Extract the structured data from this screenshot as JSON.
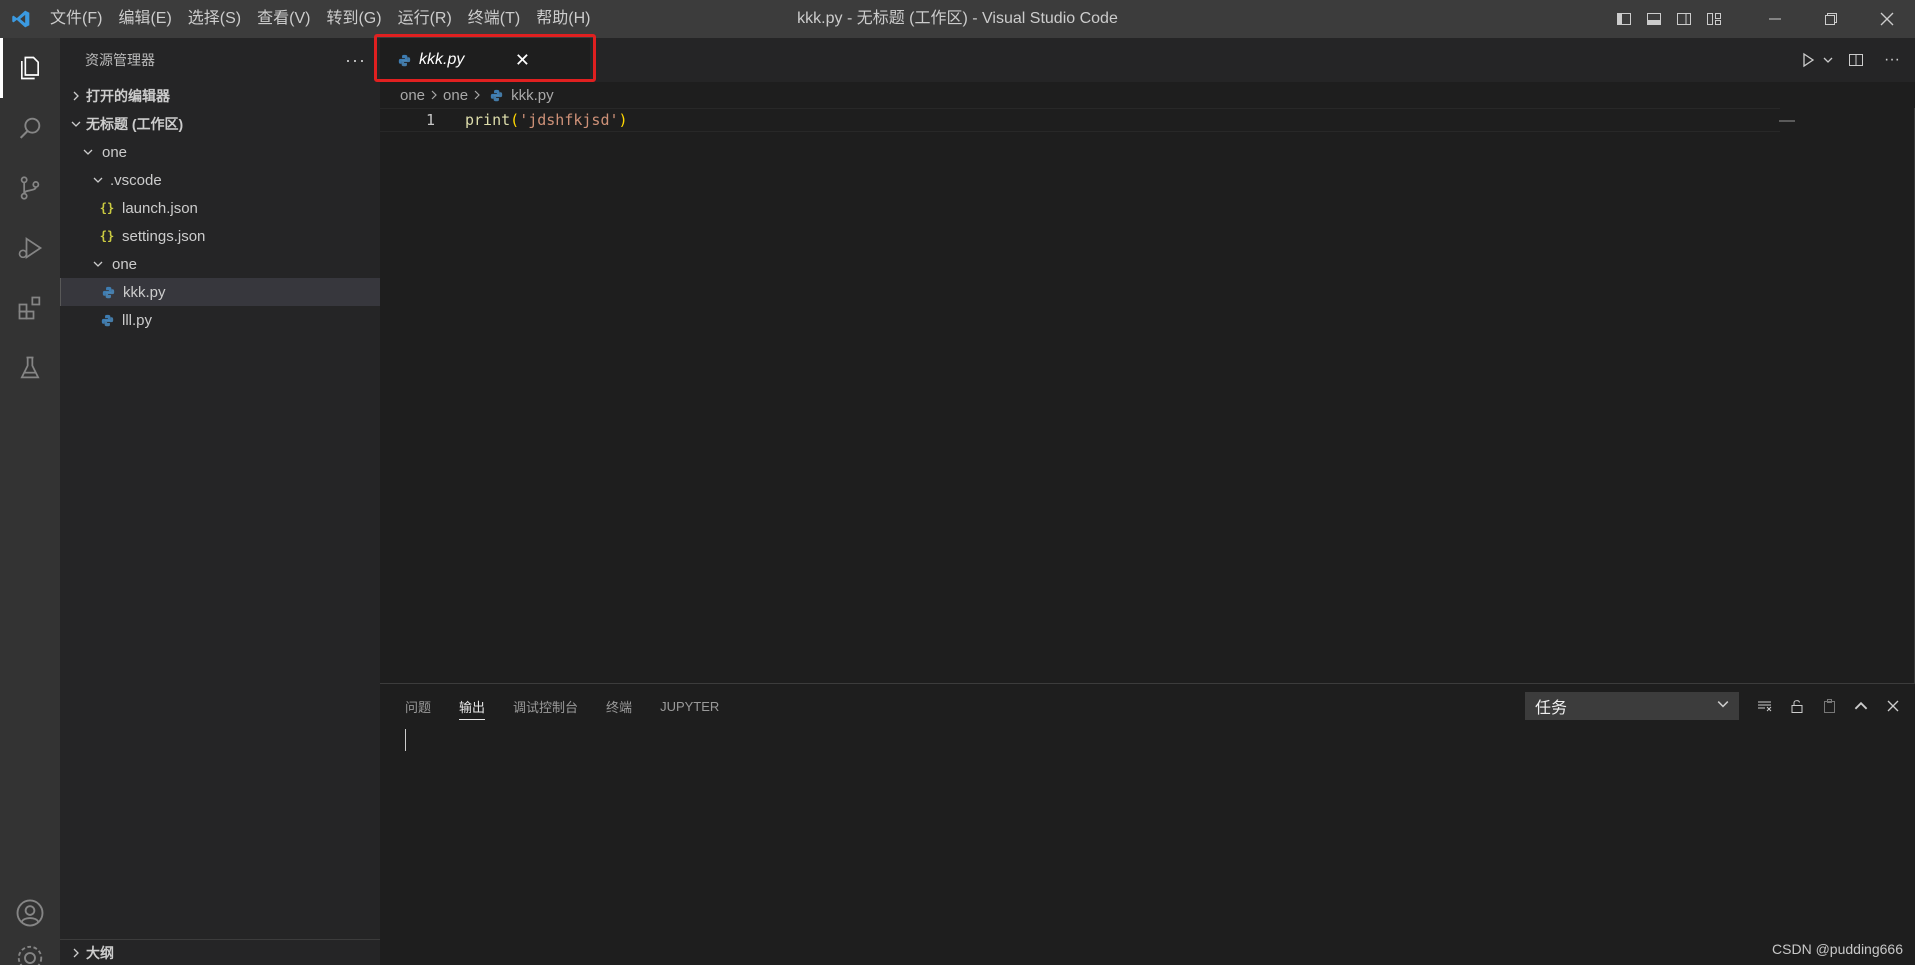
{
  "titlebar": {
    "menu": [
      "文件(F)",
      "编辑(E)",
      "选择(S)",
      "查看(V)",
      "转到(G)",
      "运行(R)",
      "终端(T)",
      "帮助(H)"
    ],
    "window_title": "kkk.py - 无标题 (工作区) - Visual Studio Code"
  },
  "sidebar": {
    "title": "资源管理器",
    "open_editors": "打开的编辑器",
    "workspace": "无标题 (工作区)",
    "tree": {
      "root": "one",
      "vscode_folder": ".vscode",
      "launch": "launch.json",
      "settings": "settings.json",
      "sub_folder": "one",
      "kkk": "kkk.py",
      "lll": "lll.py"
    },
    "outline": "大纲"
  },
  "editor": {
    "tab_label": "kkk.py",
    "breadcrumb": [
      "one",
      "one",
      "kkk.py"
    ],
    "line_number": "1",
    "code": {
      "fn": "print",
      "open": "(",
      "str": "'jdshfkjsd'",
      "close": ")"
    }
  },
  "panel": {
    "tabs": [
      "问题",
      "输出",
      "调试控制台",
      "终端",
      "JUPYTER"
    ],
    "active_tab": "输出",
    "select_value": "任务"
  },
  "watermark": "CSDN @pudding666",
  "colors": {
    "accent": "#007acc",
    "highlight_box": "#e02020",
    "python": "#3e7cb1"
  }
}
